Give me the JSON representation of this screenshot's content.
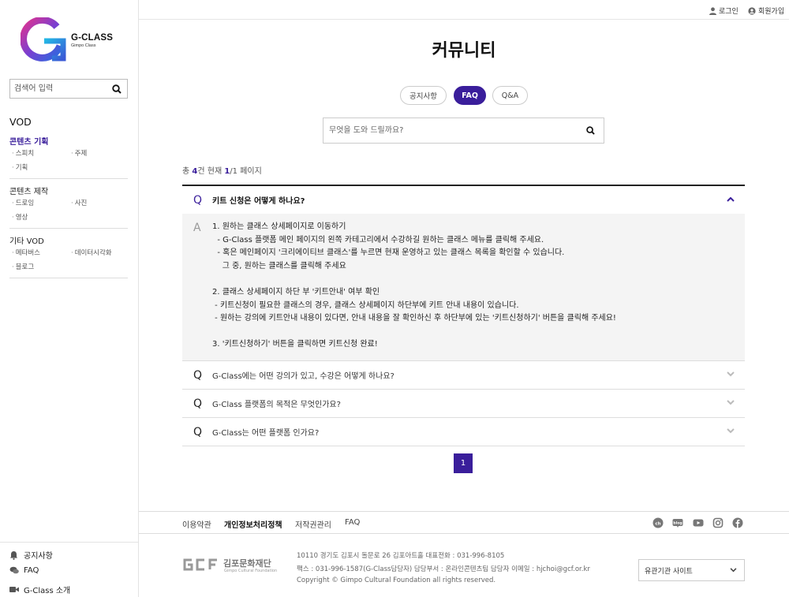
{
  "brand": {
    "name": "G-CLASS",
    "sub": "Gimpo Class"
  },
  "sidebar": {
    "search_placeholder": "검색어 입력",
    "vod_title": "VOD",
    "categories": [
      {
        "title": "콘텐츠 기획",
        "items": [
          "스피치",
          "주제",
          "기획"
        ]
      },
      {
        "title": "콘텐츠 제작",
        "items": [
          "드로잉",
          "사진",
          "영상"
        ]
      },
      {
        "title": "기타 VOD",
        "items": [
          "메타버스",
          "데이터시각화",
          "블로그"
        ]
      }
    ],
    "bottom": [
      {
        "label": "공지사항",
        "icon": "bell-icon"
      },
      {
        "label": "FAQ",
        "icon": "chat-icon"
      },
      {
        "label": "G-Class 소개",
        "icon": "video-icon"
      }
    ]
  },
  "topbar": {
    "login": "로그인",
    "signup": "회원가입"
  },
  "page": {
    "title": "커뮤니티",
    "tabs": [
      "공지사항",
      "FAQ",
      "Q&A"
    ],
    "search_placeholder": "무엇을 도와 드릴까요?",
    "count": {
      "prefix": "총 ",
      "total": "4",
      "mid": "건 현재 ",
      "current": "1",
      "suffix": "/1 페이지"
    }
  },
  "faq": {
    "q_mark": "Q",
    "a_mark": "A",
    "items": [
      {
        "question": "키트 신청은 어떻게 하나요?",
        "answer": [
          "1. 원하는 클래스 상세페이지로 이동하기",
          "  - G-Class 플랫폼 메인 페이지의 왼쪽 카테고리에서 수강하길 원하는 클래스 메뉴를 클릭해 주세요.",
          "  - 혹은 메인페이지 '크리에이티브 클래스'를 누르면 현재 운영하고 있는 클래스 목록을 확인할 수 있습니다.",
          "    그 중, 원하는 클래스를 클릭해 주세요",
          "",
          "2. 클래스 상세페이지 하단 부 '키트안내' 여부 확인",
          " - 키트신청이 필요한 클래스의 경우, 클래스 상세페이지 하단부에 키트 안내 내용이 있습니다.",
          " - 원하는 강의에 키트안내 내용이 있다면, 안내 내용을 잘 확인하신 후 하단부에 있는 '키트신청하기' 버튼을 클릭해 주세요!",
          "",
          "3. '키트신청하기' 버튼을 클릭하면 키트신청 완료!"
        ]
      },
      {
        "question": "G-Class에는 어떤 강의가 있고, 수강은 어떻게 하나요?"
      },
      {
        "question": "G-Class 플랫폼의 목적은 무엇인가요?"
      },
      {
        "question": "G-Class는 어떤 플랫폼 인가요?"
      }
    ]
  },
  "pagination": {
    "current": "1"
  },
  "footer": {
    "links": [
      "이용약관",
      "개인정보처리정책",
      "저작권관리",
      "FAQ"
    ],
    "org_name": "김포문화재단",
    "org_sub": "Gimpo Cultural Foundation",
    "address": "10110 경기도 김포시 돌문로 26 김포아트홀   대표전화 : 031-996-8105",
    "contact": "팩스 : 031-996-1587(G-Class담당자)    담당부서 : 온라인콘텐츠팀    담당자 이메일 : hjchoi@gcf.or.kr",
    "copyright": "Copyright © Gimpo Cultural Foundation all rights reserved.",
    "family_site": "유관기관 사이트",
    "social": [
      "kakao-icon",
      "blog-icon",
      "youtube-icon",
      "instagram-icon",
      "facebook-icon"
    ]
  },
  "colors": {
    "accent": "#3a1e9b"
  }
}
